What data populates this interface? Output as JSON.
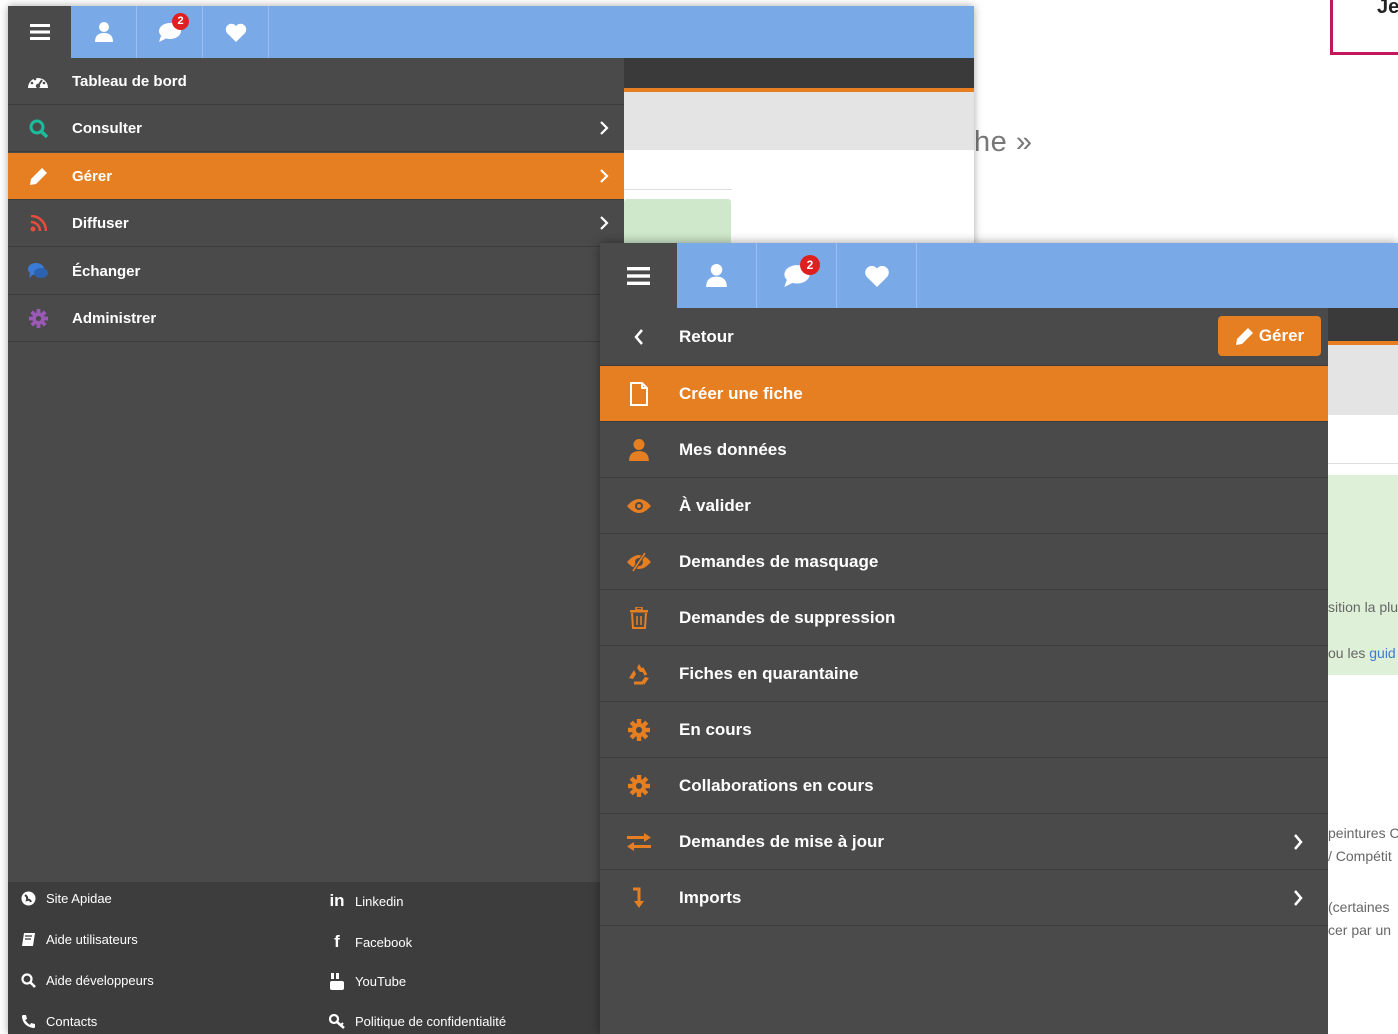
{
  "background": {
    "corner_text": "Je",
    "quote_text": "he »"
  },
  "panel1": {
    "topbar": {
      "messages_badge": "2"
    },
    "menu": [
      {
        "label": "Tableau de bord",
        "icon": "dashboard-icon",
        "icon_color": "#ffffff",
        "has_chevron": false,
        "active": false
      },
      {
        "label": "Consulter",
        "icon": "search-icon",
        "icon_color": "#1abc9c",
        "has_chevron": true,
        "active": false
      },
      {
        "label": "Gérer",
        "icon": "pencil-icon",
        "icon_color": "#ffffff",
        "has_chevron": true,
        "active": true
      },
      {
        "label": "Diffuser",
        "icon": "rss-icon",
        "icon_color": "#e74c3c",
        "has_chevron": true,
        "active": false
      },
      {
        "label": "Échanger",
        "icon": "comments-icon",
        "icon_color": "#3a7bd5",
        "has_chevron": true,
        "active": false
      },
      {
        "label": "Administrer",
        "icon": "cog-icon",
        "icon_color": "#9b59b6",
        "has_chevron": true,
        "active": false
      }
    ],
    "footer": {
      "left": [
        {
          "label": "Site Apidae",
          "icon": "globe-icon"
        },
        {
          "label": "Aide utilisateurs",
          "icon": "book-icon"
        },
        {
          "label": "Aide développeurs",
          "icon": "search-icon"
        },
        {
          "label": "Contacts",
          "icon": "phone-icon"
        }
      ],
      "right": [
        {
          "label": "Linkedin",
          "icon": "linkedin-icon"
        },
        {
          "label": "Facebook",
          "icon": "facebook-icon"
        },
        {
          "label": "YouTube",
          "icon": "youtube-icon"
        },
        {
          "label": "Politique de confidentialité",
          "icon": "key-icon"
        }
      ]
    }
  },
  "panel2": {
    "topbar": {
      "messages_badge": "2"
    },
    "back_label": "Retour",
    "section_button": "Gérer",
    "menu": [
      {
        "label": "Créer une fiche",
        "icon": "file-icon",
        "has_chevron": false,
        "active": true
      },
      {
        "label": "Mes données",
        "icon": "user-icon",
        "has_chevron": false,
        "active": false
      },
      {
        "label": "À valider",
        "icon": "eye-icon",
        "has_chevron": false,
        "active": false
      },
      {
        "label": "Demandes de masquage",
        "icon": "eye-slash-icon",
        "has_chevron": false,
        "active": false
      },
      {
        "label": "Demandes de suppression",
        "icon": "trash-icon",
        "has_chevron": false,
        "active": false
      },
      {
        "label": "Fiches en quarantaine",
        "icon": "recycle-icon",
        "has_chevron": false,
        "active": false
      },
      {
        "label": "En cours",
        "icon": "cog-icon",
        "has_chevron": false,
        "active": false
      },
      {
        "label": "Collaborations en cours",
        "icon": "cog-icon",
        "has_chevron": false,
        "active": false
      },
      {
        "label": "Demandes de mise à jour",
        "icon": "exchange-icon",
        "has_chevron": true,
        "active": false
      },
      {
        "label": "Imports",
        "icon": "level-down-icon",
        "has_chevron": true,
        "active": false
      }
    ],
    "accent_color": "#e67e22",
    "background_texts": [
      "sition la plu",
      "ou les ",
      "guid",
      "peintures C",
      "/ Compétit",
      "(certaines",
      "cer par un"
    ]
  }
}
